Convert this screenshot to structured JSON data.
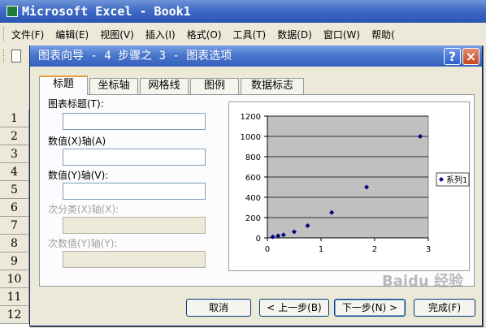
{
  "excel": {
    "title": "Microsoft Excel - Book1",
    "menus": [
      "文件(F)",
      "编辑(E)",
      "视图(V)",
      "插入(I)",
      "格式(O)",
      "工具(T)",
      "数据(D)",
      "窗口(W)",
      "帮助("
    ],
    "rows": [
      "1",
      "2",
      "3",
      "4",
      "5",
      "6",
      "7",
      "8",
      "9",
      "10",
      "11",
      "12"
    ]
  },
  "dialog": {
    "title": "图表向导 - 4 步骤之 3 - 图表选项",
    "help": "?",
    "close": "×",
    "tabs": [
      "标题",
      "坐标轴",
      "网格线",
      "图例",
      "数据标志"
    ],
    "active_tab": "标题",
    "chart_title_label": "图表标题(T):",
    "x_axis_label": "数值(X)轴(A)",
    "y_axis_label": "数值(Y)轴(V):",
    "secondary_x_label": "次分类(X)轴(X):",
    "secondary_y_label": "次数值(Y)轴(Y):",
    "buttons": {
      "cancel": "取消",
      "back": "< 上一步(B)",
      "next": "下一步(N) >",
      "finish": "完成(F)"
    }
  },
  "chart_data": {
    "type": "scatter",
    "series": [
      {
        "name": "系列1",
        "x": [
          0.1,
          0.2,
          0.3,
          0.5,
          0.75,
          1.2,
          1.85,
          2.85
        ],
        "y": [
          10,
          20,
          30,
          60,
          120,
          250,
          500,
          1000
        ]
      }
    ],
    "xlim": [
      0,
      3
    ],
    "ylim": [
      0,
      1200
    ],
    "xticks": [
      "0",
      "1",
      "2",
      "3"
    ],
    "yticks": [
      "0",
      "200",
      "400",
      "600",
      "800",
      "1000",
      "1200"
    ],
    "grid": "horizontal",
    "plot_background": "#c0c0c0",
    "marker_color": "#000080",
    "legend_position": "right"
  },
  "watermark": "Baidu 经验"
}
